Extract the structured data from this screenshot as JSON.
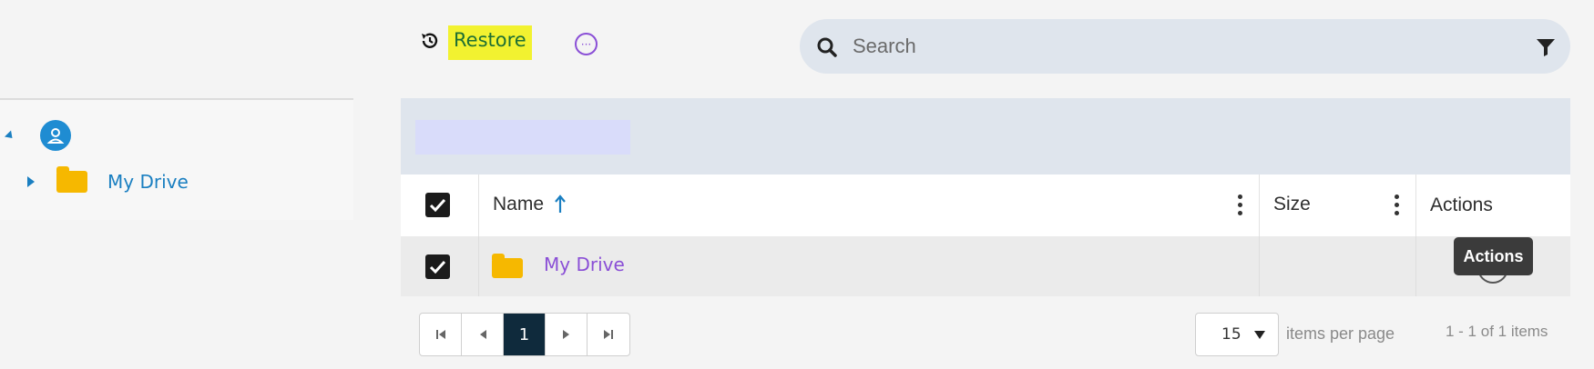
{
  "toolbar": {
    "restore_label": "Restore"
  },
  "search": {
    "placeholder": "Search"
  },
  "tree": {
    "root_label": "",
    "items": [
      {
        "label": "My Drive"
      }
    ]
  },
  "grid": {
    "columns": {
      "name": "Name",
      "size": "Size",
      "actions": "Actions"
    },
    "rows": [
      {
        "name": "My Drive",
        "size": "",
        "checked": true
      }
    ],
    "header_checked": true
  },
  "tooltip": {
    "text": "Actions"
  },
  "pager": {
    "pages": [
      "1"
    ],
    "current_page": "1",
    "page_size": "15",
    "per_page_label": "items per page",
    "count_text": "1 - 1 of 1 items"
  },
  "colors": {
    "accent": "#1a7fc1",
    "link_purple": "#8a4fd6",
    "highlight": "#f2f230",
    "folder": "#f6b800",
    "pager_active": "#0f2a3c"
  },
  "icons": {
    "restore": "history-icon",
    "more": "more-horizontal-icon",
    "search": "search-icon",
    "filter": "filter-icon",
    "user": "user-icon",
    "folder": "folder-icon",
    "sort": "arrow-up-icon",
    "column_menu": "kebab-icon"
  }
}
